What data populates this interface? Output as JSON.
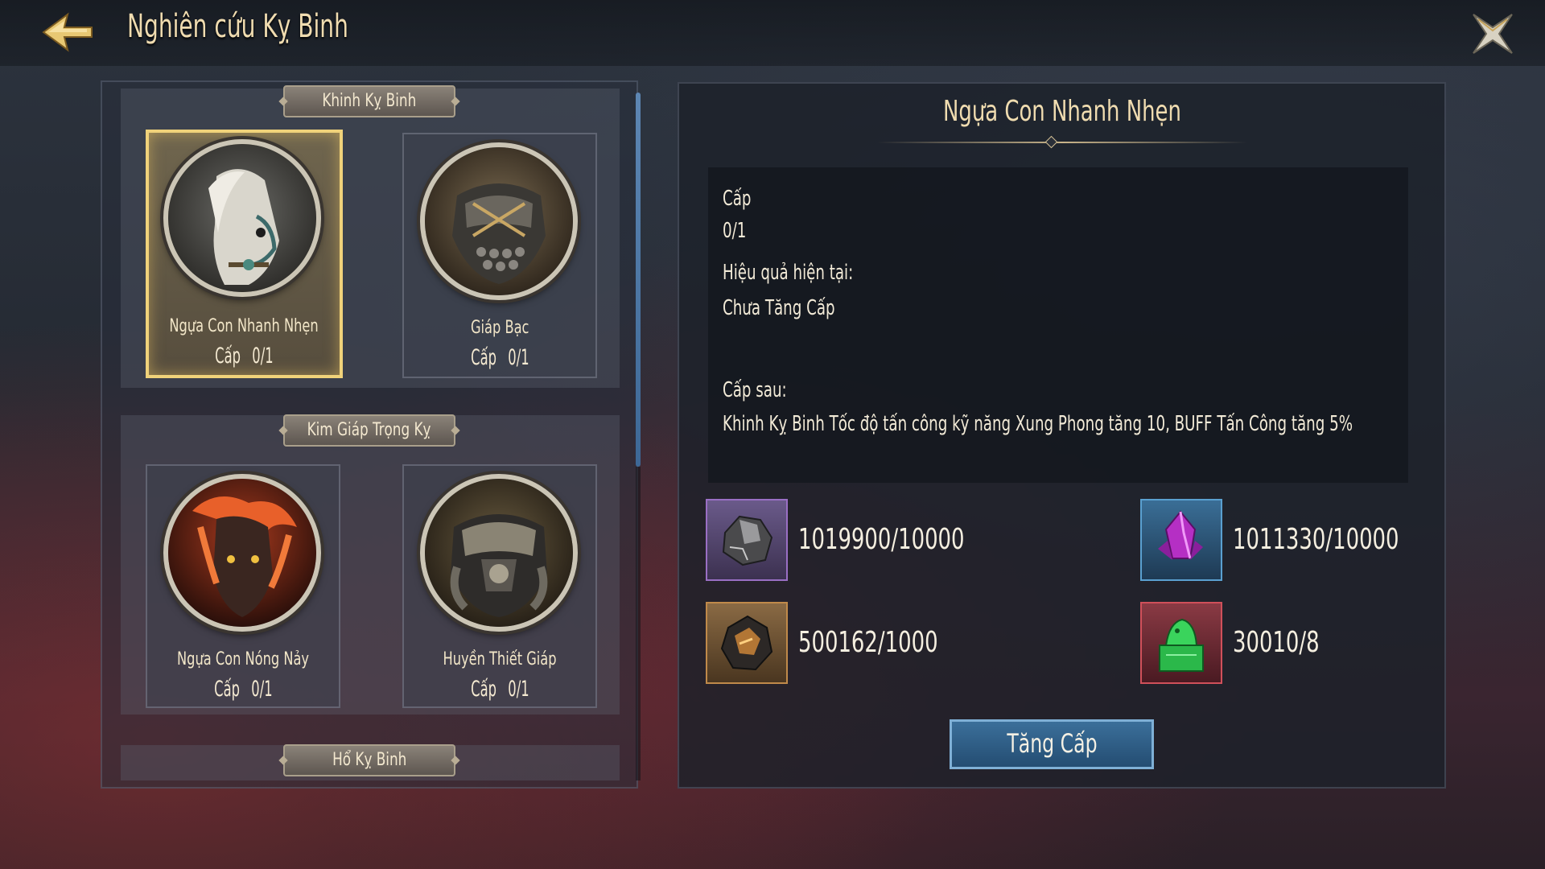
{
  "header": {
    "title": "Nghiên cứu Kỵ Binh"
  },
  "groups": [
    {
      "name": "Khinh Kỵ Binh"
    },
    {
      "name": "Kim Giáp Trọng Kỵ"
    },
    {
      "name": "Hổ Kỵ Binh"
    }
  ],
  "cards": [
    {
      "name": "Ngựa Con Nhanh Nhẹn",
      "level_label": "Cấp",
      "level": "0/1",
      "selected": true
    },
    {
      "name": "Giáp Bạc",
      "level_label": "Cấp",
      "level": "0/1",
      "selected": false
    },
    {
      "name": "Ngựa Con Nóng Nảy",
      "level_label": "Cấp",
      "level": "0/1",
      "selected": false
    },
    {
      "name": "Huyền Thiết Giáp",
      "level_label": "Cấp",
      "level": "0/1",
      "selected": false
    }
  ],
  "detail": {
    "title": "Ngựa Con Nhanh Nhẹn",
    "level_label": "Cấp",
    "level_value": "0/1",
    "current_effect_label": "Hiệu quả hiện tại:",
    "current_effect_value": "Chưa Tăng Cấp",
    "next_level_label": "Cấp sau:",
    "next_level_value": "Khinh Kỵ Binh Tốc độ tấn công kỹ năng Xung Phong tăng 10, BUFF Tấn Công tăng 5%"
  },
  "resources": [
    {
      "icon": "iron-ore-icon",
      "amount": "1019900/10000",
      "frame_color": "#9a6fc4"
    },
    {
      "icon": "purple-crystal-icon",
      "amount": "1011330/10000",
      "frame_color": "#5aa0d0"
    },
    {
      "icon": "meteorite-ore-icon",
      "amount": "500162/1000",
      "frame_color": "#c08a4a"
    },
    {
      "icon": "jade-seal-icon",
      "amount": "30010/8",
      "frame_color": "#d0505a"
    }
  ],
  "actions": {
    "upgrade_label": "Tăng Cấp"
  }
}
